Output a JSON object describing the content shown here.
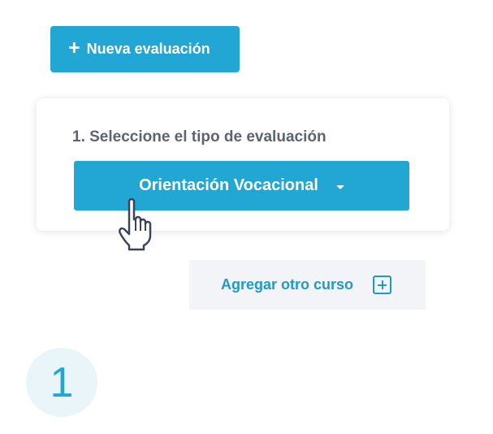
{
  "toolbar": {
    "new_evaluation_label": "Nueva evaluación"
  },
  "card": {
    "step_title": "1. Seleccione el tipo de evaluación",
    "selected_type": "Orientación Vocacional"
  },
  "add_course": {
    "label": "Agregar otro curso"
  },
  "step_badge": {
    "number": "1"
  },
  "icons": {
    "new_evaluation": "plus-icon",
    "select_caret": "caret-down-icon",
    "cursor": "hand-pointer-icon",
    "add_course": "plus-square-icon"
  },
  "colors": {
    "accent": "#22a6d3",
    "link": "#1c9bc8",
    "text_muted": "#5b6470",
    "add_course_bg": "#f3f4f7",
    "badge_bg": "#e9f5f9"
  }
}
